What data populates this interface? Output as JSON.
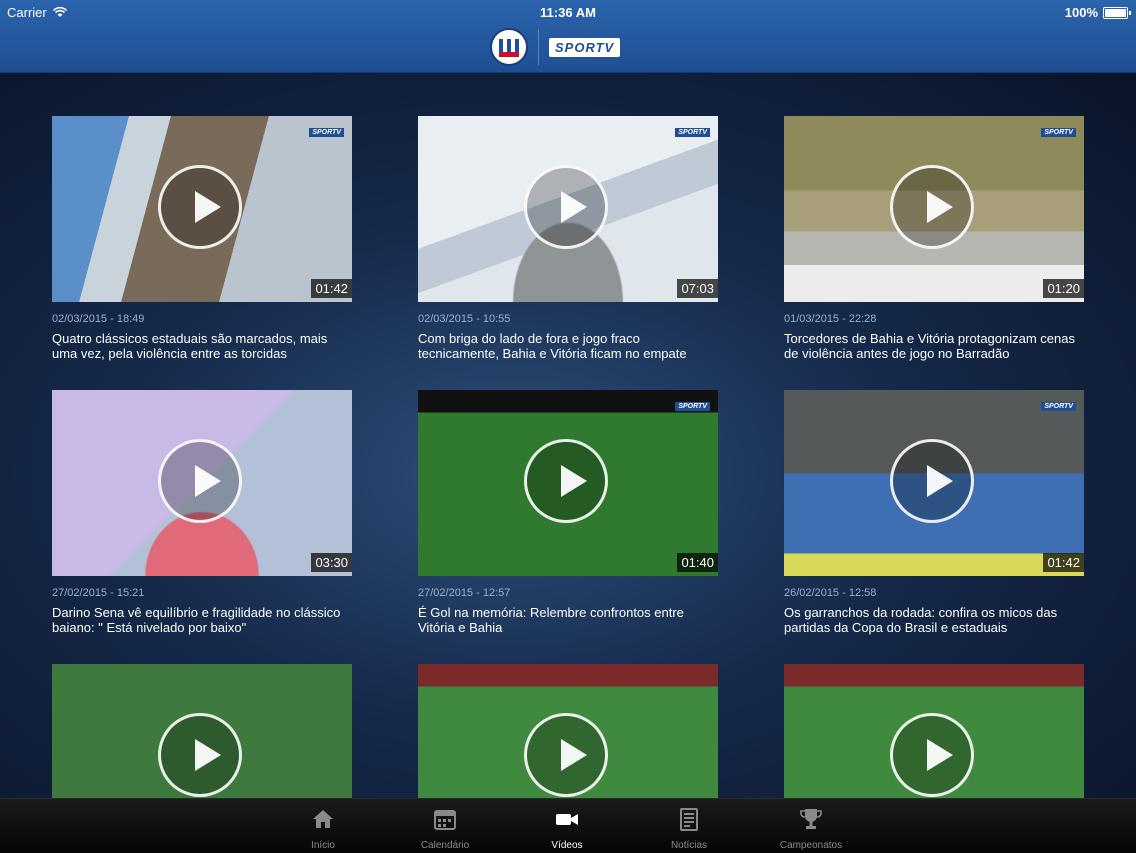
{
  "status_bar": {
    "carrier": "Carrier",
    "time": "11:36 AM",
    "battery": "100%"
  },
  "header": {
    "channel_logo_text": "SPORTV"
  },
  "videos": [
    {
      "date": "02/03/2015 - 18:49",
      "title": "Quatro clássicos estaduais são marcados, mais uma vez, pela violência entre as torcidas",
      "duration": "01:42"
    },
    {
      "date": "02/03/2015 - 10:55",
      "title": "Com briga do lado de fora e jogo fraco tecnicamente, Bahia e Vitória ficam no empate",
      "duration": "07:03"
    },
    {
      "date": "01/03/2015 - 22:28",
      "title": "Torcedores de Bahia e Vitória protagonizam cenas de violência antes de jogo no Barradão",
      "duration": "01:20"
    },
    {
      "date": "27/02/2015 - 15:21",
      "title": "Darino Sena vê equilíbrio e fragilidade no clássico baiano: \" Está nivelado por baixo\"",
      "duration": "03:30"
    },
    {
      "date": "27/02/2015 - 12:57",
      "title": "É Gol na memória: Relembre confrontos entre Vitória e Bahia",
      "duration": "01:40"
    },
    {
      "date": "26/02/2015 - 12:58",
      "title": "Os garranchos da rodada: confira os micos das partidas da Copa do Brasil e estaduais",
      "duration": "01:42"
    },
    {
      "date": "",
      "title": "",
      "duration": ""
    },
    {
      "date": "",
      "title": "",
      "duration": ""
    },
    {
      "date": "",
      "title": "",
      "duration": ""
    }
  ],
  "tabs": [
    {
      "label": "Início",
      "icon": "home-icon"
    },
    {
      "label": "Calendário",
      "icon": "calendar-icon"
    },
    {
      "label": "Vídeos",
      "icon": "video-camera-icon",
      "active": true
    },
    {
      "label": "Notícias",
      "icon": "news-icon"
    },
    {
      "label": "Campeonatos",
      "icon": "trophy-icon"
    }
  ],
  "colors": {
    "header": "#2b64ad",
    "tabbar": "#0d0d0d",
    "active_tab": "#ffffff",
    "inactive_tab": "#8a8a8a"
  }
}
